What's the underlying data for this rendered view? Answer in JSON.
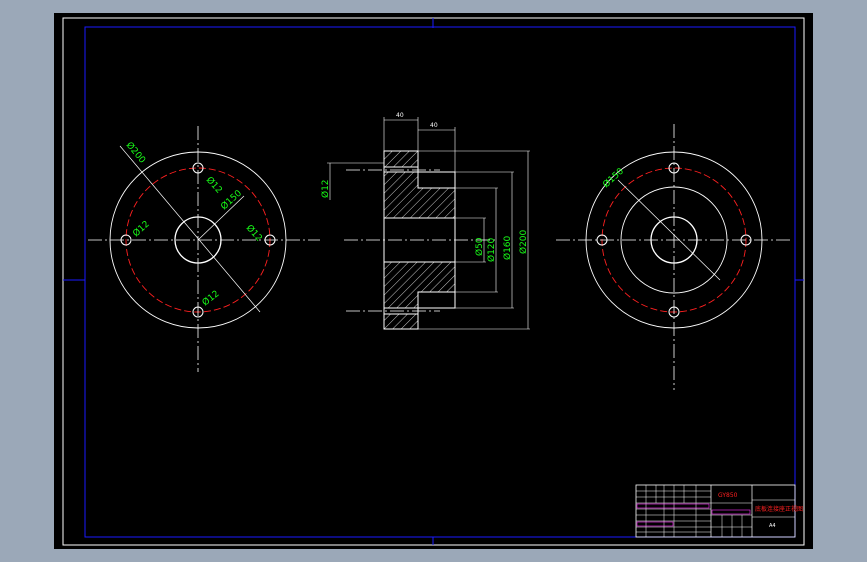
{
  "drawing": {
    "dimensions": {
      "left_outer_dia": "Ø200",
      "left_hole_top": "Ø12",
      "left_pcd": "Ø150",
      "left_hole_left": "Ø12",
      "left_hole_right": "Ø12",
      "left_hole_bottom": "Ø12",
      "mid_width_1": "40",
      "mid_width_2": "40",
      "mid_hole": "Ø12",
      "mid_d1": "Ø50",
      "mid_d2": "Ø120",
      "mid_d3": "Ø160",
      "mid_d4": "Ø200",
      "right_pcd": "Ø150"
    },
    "title_block": {
      "part_code": "GY850",
      "drawing_title": "底板连接座正视图",
      "sheet_size": "A4"
    }
  },
  "colors": {
    "border": "#1a1aff",
    "geometry": "#ffffff",
    "centerline_red": "#ff2020",
    "dimension": "#18ff18",
    "title_red": "#ff2020",
    "title_magenta": "#ff30ff"
  }
}
